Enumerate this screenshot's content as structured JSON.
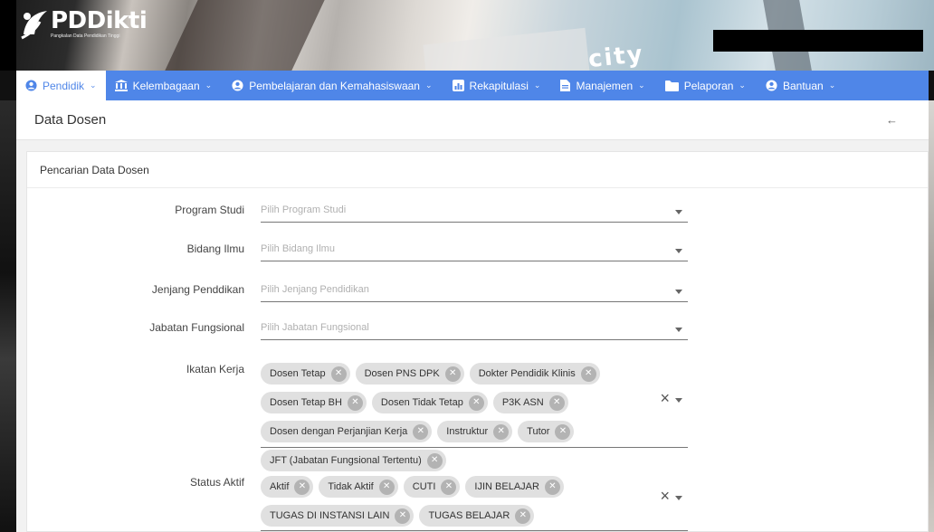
{
  "brand": {
    "name": "PDDikti",
    "tagline": "Pangkalan Data Pendidikan Tinggi",
    "banner_text": "city"
  },
  "nav": [
    {
      "label": "Pendidik",
      "icon": "user-circle-icon",
      "active": true
    },
    {
      "label": "Kelembagaan",
      "icon": "institution-icon",
      "active": false
    },
    {
      "label": "Pembelajaran dan Kemahasiswaan",
      "icon": "user-circle-icon",
      "active": false
    },
    {
      "label": "Rekapitulasi",
      "icon": "chart-icon",
      "active": false
    },
    {
      "label": "Manajemen",
      "icon": "document-icon",
      "active": false
    },
    {
      "label": "Pelaporan",
      "icon": "folder-icon",
      "active": false
    },
    {
      "label": "Bantuan",
      "icon": "user-circle-icon",
      "active": false
    }
  ],
  "page": {
    "title": "Data Dosen",
    "back_icon": "arrow-left-icon"
  },
  "card": {
    "header": "Pencarian Data Dosen"
  },
  "form": {
    "program_studi": {
      "label": "Program Studi",
      "placeholder": "Pilih Program Studi"
    },
    "bidang_ilmu": {
      "label": "Bidang Ilmu",
      "placeholder": "Pilih Bidang Ilmu"
    },
    "jenjang": {
      "label": "Jenjang Penddikan",
      "placeholder": "Pilih Jenjang Pendidikan"
    },
    "jabatan": {
      "label": "Jabatan Fungsional",
      "placeholder": "Pilih Jabatan Fungsional"
    },
    "ikatan_kerja": {
      "label": "Ikatan Kerja",
      "chips": [
        "Dosen Tetap",
        "Dosen PNS DPK",
        "Dokter Pendidik Klinis",
        "Dosen Tetap BH",
        "Dosen Tidak Tetap",
        "P3K ASN",
        "Dosen dengan Perjanjian Kerja",
        "Instruktur",
        "Tutor",
        "JFT (Jabatan Fungsional Tertentu)"
      ]
    },
    "status_aktif": {
      "label": "Status Aktif",
      "chips": [
        "Aktif",
        "Tidak Aktif",
        "CUTI",
        "IJIN BELAJAR",
        "TUGAS DI INSTANSI LAIN",
        "TUGAS BELAJAR"
      ]
    },
    "clear_symbol": "×",
    "chip_remove_symbol": "✕"
  },
  "colors": {
    "nav_bg": "#4f86e8",
    "chip_bg": "#e0e0e0",
    "chip_remove_bg": "#b3b3b3"
  }
}
